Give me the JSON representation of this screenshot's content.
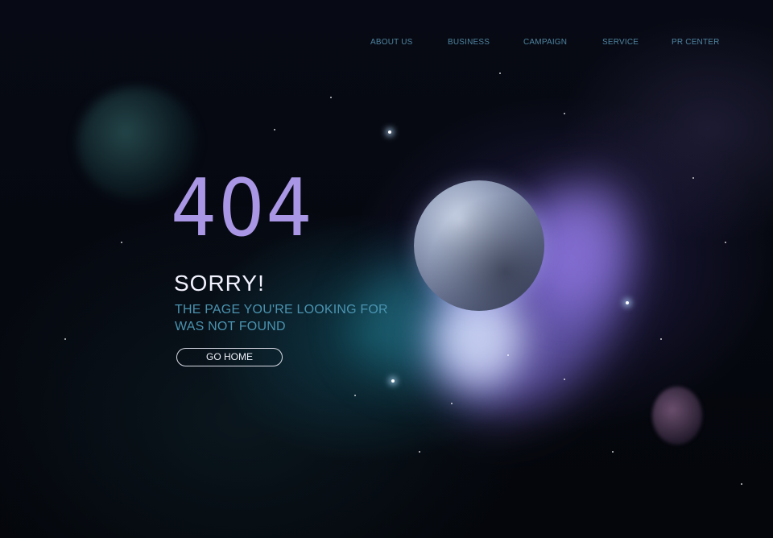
{
  "nav": {
    "items": [
      {
        "label": "ABOUT US"
      },
      {
        "label": "BUSINESS"
      },
      {
        "label": "CAMPAIGN"
      },
      {
        "label": "SERVICE"
      },
      {
        "label": "PR CENTER"
      }
    ]
  },
  "error": {
    "code": "404",
    "title": "SORRY!",
    "message": "THE PAGE YOU'RE LOOKING FOR\nWAS NOT FOUND",
    "button_label": "GO HOME"
  },
  "colors": {
    "accent_code": "#a996e4",
    "message_text": "#4a93b0",
    "nav_text": "#4f84a0",
    "background": "#05070e"
  }
}
